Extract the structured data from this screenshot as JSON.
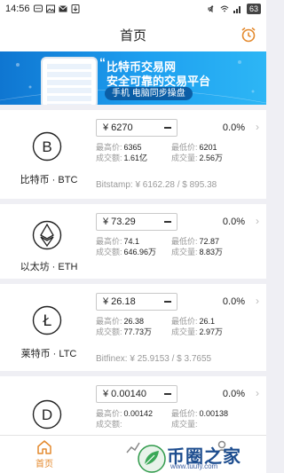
{
  "status_bar": {
    "time": "14:56",
    "battery": "63"
  },
  "header": {
    "title": "首页"
  },
  "banner": {
    "line1": "比特币交易网",
    "line2": "安全可靠的交易平台",
    "tagline": "手机   电脑同步操盘"
  },
  "coins": [
    {
      "name": "比特币 · BTC",
      "symbol": "B",
      "price": "¥ 6270",
      "change": "0.0%",
      "high_label": "最高价:",
      "high": "6365",
      "low_label": "最低价:",
      "low": "6201",
      "turnover_label": "成交额:",
      "turnover": "1.61亿",
      "volume_label": "成交量:",
      "volume": "2.56万",
      "footer": "Bitstamp: ¥ 6162.28 / $ 895.38"
    },
    {
      "name": "以太坊 · ETH",
      "symbol": "E",
      "price": "¥ 73.29",
      "change": "0.0%",
      "high_label": "最高价:",
      "high": "74.1",
      "low_label": "最低价:",
      "low": "72.87",
      "turnover_label": "成交额:",
      "turnover": "646.96万",
      "volume_label": "成交量:",
      "volume": "8.83万",
      "footer": ""
    },
    {
      "name": "莱特币 · LTC",
      "symbol": "Ł",
      "price": "¥ 26.18",
      "change": "0.0%",
      "high_label": "最高价:",
      "high": "26.38",
      "low_label": "最低价:",
      "low": "26.1",
      "turnover_label": "成交额:",
      "turnover": "77.73万",
      "volume_label": "成交量:",
      "volume": "2.97万",
      "footer": "Bitfinex: ¥ 25.9153 / $ 3.7655"
    },
    {
      "name": "",
      "symbol": "D",
      "price": "¥ 0.00140",
      "change": "0.0%",
      "high_label": "最高价:",
      "high": "0.00142",
      "low_label": "最低价:",
      "low": "0.00138",
      "turnover_label": "成交额:",
      "turnover": "",
      "volume_label": "成交量:",
      "volume": "",
      "footer": ""
    }
  ],
  "tabs": [
    {
      "label": "首页",
      "icon": "home-icon",
      "active": true
    },
    {
      "label": "",
      "icon": "chart-icon",
      "active": false
    },
    {
      "label": "",
      "icon": "user-icon",
      "active": false
    }
  ],
  "watermark": {
    "title": "币圈之家",
    "url": "www.tuufy.com"
  },
  "colors": {
    "accent": "#e48a2e",
    "banner_blue": "#1ea0f0",
    "text": "#222222",
    "muted": "#999999"
  }
}
